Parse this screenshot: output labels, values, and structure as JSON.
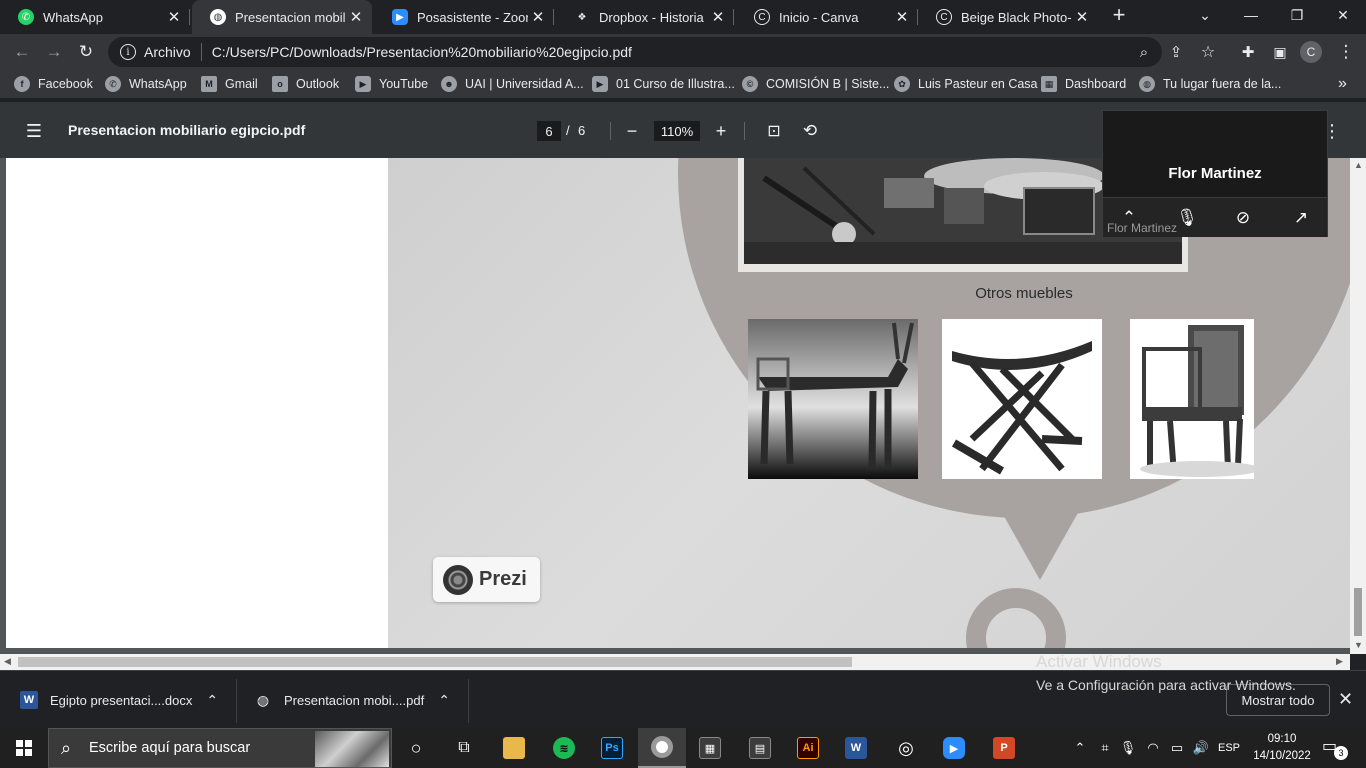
{
  "browser": {
    "tabs": [
      {
        "title": "WhatsApp",
        "icon": "whatsapp-icon",
        "color": "#25d366",
        "active": false
      },
      {
        "title": "Presentacion mobiliari",
        "icon": "globe-icon",
        "color": "#ffffff",
        "active": true
      },
      {
        "title": "Posasistente - Zoom",
        "icon": "zoom-icon",
        "color": "#2d8cff",
        "active": false
      },
      {
        "title": "Dropbox - Historia - S",
        "icon": "dropbox-icon",
        "color": "#0061ff",
        "active": false
      },
      {
        "title": "Inicio - Canva",
        "icon": "canva-icon",
        "color": "#00c4cc",
        "active": false
      },
      {
        "title": "Beige Black Photo-cen",
        "icon": "canva-icon",
        "color": "#00c4cc",
        "active": false
      }
    ],
    "new_tab": "+",
    "window_controls": {
      "minimize": "—",
      "maximize": "❐",
      "close": "✕",
      "tab_search": "⌄"
    },
    "omnibox": {
      "label": "Archivo",
      "url": "C:/Users/PC/Downloads/Presentacion%20mobiliario%20egipcio.pdf"
    },
    "profile_initial": "C",
    "bookmarks": [
      {
        "label": "Facebook",
        "icon": "facebook-icon"
      },
      {
        "label": "WhatsApp",
        "icon": "whatsapp-icon"
      },
      {
        "label": "Gmail",
        "icon": "gmail-icon"
      },
      {
        "label": "Outlook",
        "icon": "outlook-icon"
      },
      {
        "label": "YouTube",
        "icon": "youtube-icon"
      },
      {
        "label": "UAI | Universidad A...",
        "icon": "uai-icon"
      },
      {
        "label": "01 Curso de Illustra...",
        "icon": "youtube-icon"
      },
      {
        "label": "COMISIÓN B | Siste...",
        "icon": "copyright-icon"
      },
      {
        "label": "Luis Pasteur en Casa",
        "icon": "pasteur-icon"
      },
      {
        "label": "Dashboard",
        "icon": "dashboard-icon"
      },
      {
        "label": "Tu lugar fuera de la...",
        "icon": "globe-icon"
      }
    ],
    "bookmarks_overflow": "»"
  },
  "pdf_viewer": {
    "title": "Presentacion mobiliario egipcio.pdf",
    "current_page": "6",
    "page_separator": "/",
    "total_pages": "6",
    "zoom": "110%",
    "minus": "−",
    "plus": "+"
  },
  "slide": {
    "caption": "Otros muebles",
    "prezi_label": "Prezi"
  },
  "zoom_meeting": {
    "participant_name": "Flor Martinez",
    "participant_sub": "Flor Martinez"
  },
  "watermark": {
    "line1": "Activar Windows",
    "line2": "Ve a Configuración para activar Windows."
  },
  "downloads": [
    {
      "name": "Egipto presentaci....docx",
      "icon": "word-doc-icon"
    },
    {
      "name": "Presentacion mobi....pdf",
      "icon": "pdf-file-icon"
    }
  ],
  "show_all_label": "Mostrar todo",
  "taskbar": {
    "search_placeholder": "Escribe aquí para buscar",
    "language": "ESP",
    "time": "09:10",
    "date": "14/10/2022",
    "notifications": "3"
  }
}
